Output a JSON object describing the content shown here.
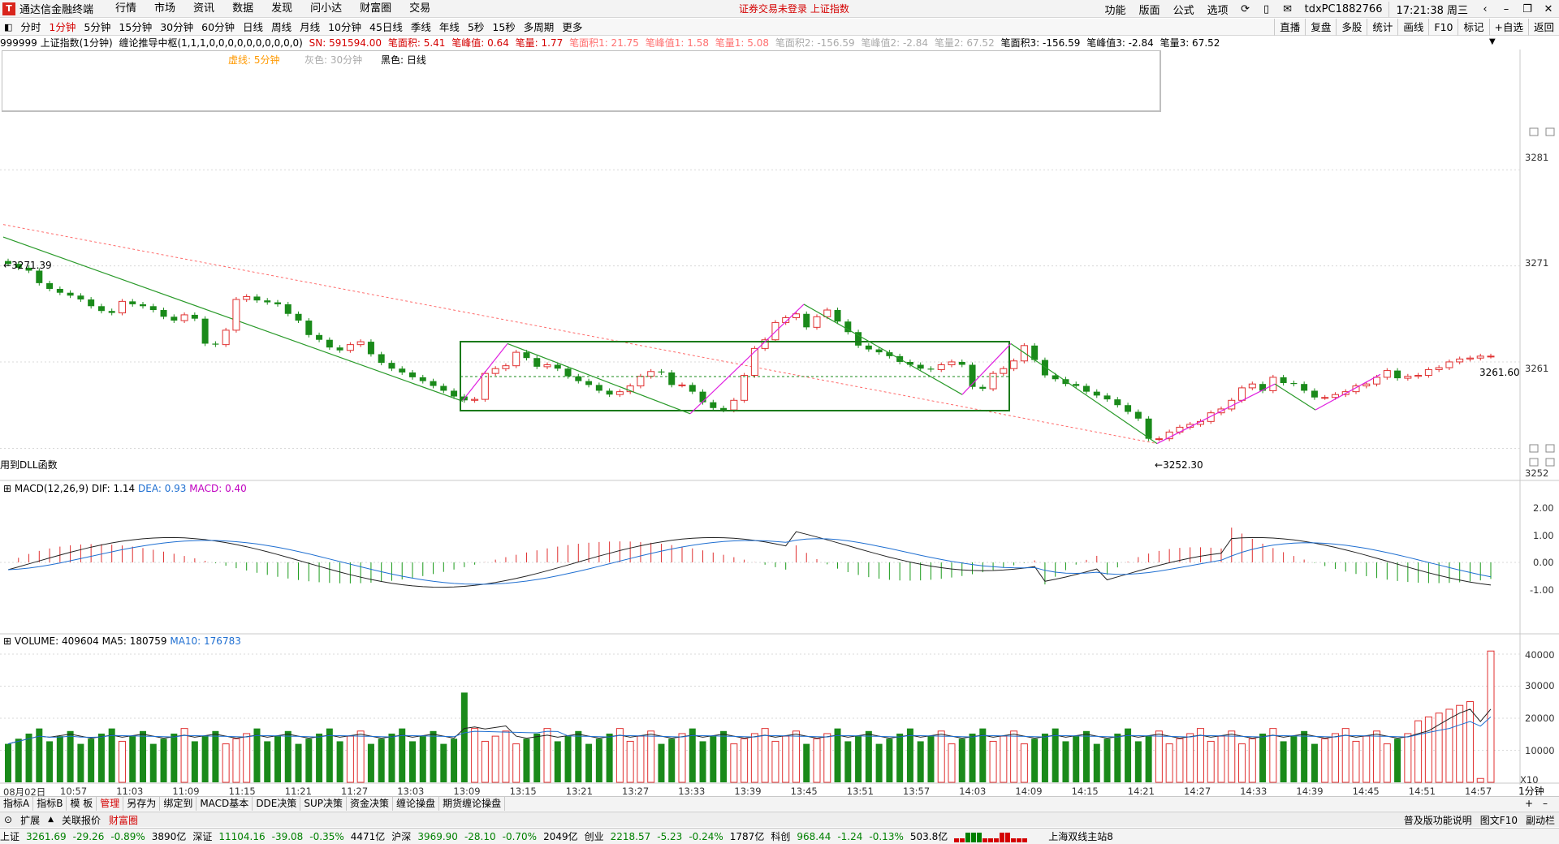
{
  "app": {
    "name": "通达信金融终端",
    "notice": "证券交易未登录  上证指数",
    "menu": [
      "行情",
      "市场",
      "资讯",
      "数据",
      "发现",
      "问小达",
      "财富圈",
      "交易"
    ],
    "right_menu": [
      "功能",
      "版面",
      "公式",
      "选项"
    ],
    "user": "tdxPC1882766",
    "clock": "17:21:38 周三"
  },
  "periods": {
    "items": [
      "分时",
      "1分钟",
      "5分钟",
      "15分钟",
      "30分钟",
      "60分钟",
      "日线",
      "周线",
      "月线",
      "10分钟",
      "45日线",
      "季线",
      "年线",
      "5秒",
      "15秒",
      "多周期",
      "更多"
    ],
    "active": "1分钟"
  },
  "toolbar": [
    "直播",
    "复盘",
    "多股",
    "统计",
    "画线",
    "F10",
    "标记",
    "+自选",
    "返回"
  ],
  "info": {
    "code": "999999 上证指数(1分钟)",
    "indicator": "缠论推导中枢(1,1,1,0,0,0,0,0,0,0,0,0,0)",
    "sn": "SN: 591594.00",
    "a1": "笔面积: 5.41",
    "a2": "笔峰值: 0.64",
    "a3": "笔量: 1.77",
    "b1": "笔面积1: 21.75",
    "b2": "笔峰值1: 1.58",
    "b3": "笔量1: 5.08",
    "c1": "笔面积2: -156.59",
    "c2": "笔峰值2: -2.84",
    "c3": "笔量2: 67.52",
    "d1": "笔面积3: -156.59",
    "d2": "笔峰值3: -2.84",
    "d3": "笔量3: 67.52"
  },
  "legend": {
    "dashed": "虚线: 5分钟",
    "gray": "灰色: 30分钟",
    "black": "黑色: 日线"
  },
  "price_panel": {
    "y_labels": [
      "3281",
      "3271",
      "3261",
      "3252"
    ],
    "high_label": "3271.39",
    "low_label": "3252.30",
    "last_label": "3261.60",
    "dll_note": "用到DLL函数"
  },
  "macd_panel": {
    "label": "MACD(12,26,9)",
    "dif": "DIF: 1.14",
    "dea": "DEA: 0.93",
    "macd": "MACD: 0.40",
    "y_labels": [
      "2.00",
      "1.00",
      "0.00",
      "-1.00"
    ]
  },
  "volume_panel": {
    "label": "VOLUME: 409604",
    "ma5": "MA5: 180759",
    "ma10": "MA10: 176783",
    "y_labels": [
      "40000",
      "30000",
      "20000",
      "10000"
    ],
    "unit": "X10"
  },
  "x_axis": [
    "08月02日",
    "10:57",
    "11:03",
    "11:09",
    "11:15",
    "11:21",
    "11:27",
    "13:03",
    "13:09",
    "13:15",
    "13:21",
    "13:27",
    "13:33",
    "13:39",
    "13:45",
    "13:51",
    "13:57",
    "14:03",
    "14:09",
    "14:15",
    "14:21",
    "14:27",
    "14:33",
    "14:39",
    "14:45",
    "14:51",
    "14:57"
  ],
  "period_corner": "1分钟",
  "bottom_tabs": {
    "items": [
      "指标A",
      "指标B",
      "模 板",
      "管理",
      "另存为",
      "绑定到",
      "MACD基本",
      "DDE决策",
      "SUP决策",
      "资金决策",
      "缠论操盘",
      "期货缠论操盘"
    ],
    "active": "管理"
  },
  "bottom_tabs2": {
    "items": [
      "扩展",
      "关联报价",
      "财富圈"
    ],
    "right": [
      "普及版功能说明",
      "图文F10",
      "副动栏"
    ]
  },
  "status": {
    "sh": {
      "name": "上证",
      "price": "3261.69",
      "chg": "-29.26",
      "pct": "-0.89%",
      "amt": "3890亿"
    },
    "sz": {
      "name": "深证",
      "price": "11104.16",
      "chg": "-39.08",
      "pct": "-0.35%",
      "amt": "4471亿"
    },
    "hs": {
      "name": "沪深",
      "price": "3969.90",
      "chg": "-28.10",
      "pct": "-0.70%",
      "amt": "2049亿"
    },
    "cy": {
      "name": "创业",
      "price": "2218.57",
      "chg": "-5.23",
      "pct": "-0.24%",
      "amt": "1787亿"
    },
    "kc": {
      "name": "科创",
      "price": "968.44",
      "chg": "-1.24",
      "pct": "-0.13%",
      "amt": "503.8亿"
    },
    "server": "上海双线主站8"
  },
  "chart_data": {
    "type": "candlestick",
    "interval": "1分钟",
    "price_range": [
      3249,
      3286
    ],
    "candles_close": [
      3271.2,
      3270.8,
      3270.5,
      3269.2,
      3268.6,
      3268.2,
      3267.9,
      3267.5,
      3266.8,
      3266.3,
      3266.1,
      3267.3,
      3267.0,
      3266.8,
      3266.4,
      3265.7,
      3265.3,
      3265.9,
      3265.5,
      3262.9,
      3262.8,
      3264.3,
      3267.5,
      3267.8,
      3267.4,
      3267.2,
      3267.0,
      3266.0,
      3265.3,
      3263.8,
      3263.3,
      3262.5,
      3262.2,
      3262.8,
      3263.1,
      3261.8,
      3260.9,
      3260.3,
      3259.9,
      3259.4,
      3259.0,
      3258.5,
      3258.0,
      3257.4,
      3257.0,
      3257.1,
      3259.8,
      3260.3,
      3260.6,
      3262.0,
      3261.4,
      3260.5,
      3260.7,
      3260.3,
      3259.5,
      3259.0,
      3258.6,
      3258.0,
      3257.6,
      3257.9,
      3258.5,
      3259.5,
      3260.0,
      3259.9,
      3258.6,
      3258.6,
      3257.9,
      3256.8,
      3256.2,
      3256.0,
      3257.0,
      3259.6,
      3262.4,
      3263.3,
      3265.1,
      3265.6,
      3266.0,
      3264.6,
      3265.7,
      3266.4,
      3265.2,
      3264.1,
      3262.7,
      3262.3,
      3262.0,
      3261.6,
      3261.0,
      3260.7,
      3260.3,
      3260.2,
      3260.7,
      3261.0,
      3260.7,
      3258.4,
      3258.2,
      3259.8,
      3260.3,
      3261.1,
      3262.7,
      3261.2,
      3259.6,
      3259.2,
      3258.7,
      3258.5,
      3257.9,
      3257.5,
      3257.1,
      3256.5,
      3255.8,
      3255.1,
      3253.0,
      3253.0,
      3253.7,
      3254.2,
      3254.5,
      3254.8,
      3255.7,
      3256.1,
      3257.0,
      3258.3,
      3258.7,
      3258.0,
      3259.4,
      3258.8,
      3258.7,
      3258.0,
      3257.3,
      3257.3,
      3257.6,
      3257.9,
      3258.5,
      3258.7,
      3259.4,
      3260.1,
      3259.3,
      3259.5,
      3259.6,
      3260.2,
      3260.4,
      3261.0,
      3261.3,
      3261.4,
      3261.6,
      3261.6
    ]
  }
}
